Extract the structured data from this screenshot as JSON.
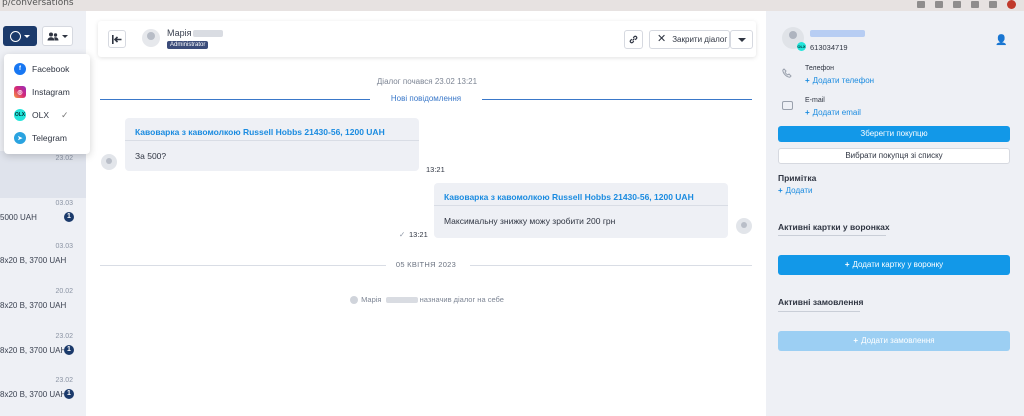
{
  "browser": {
    "url": "p/conversations"
  },
  "left": {
    "items": [
      {
        "date": "23.02",
        "text": "",
        "badge": ""
      },
      {
        "date": "03.03",
        "text": "5000 UAH",
        "badge": "1"
      },
      {
        "date": "03.03",
        "text": "8x20 B, 3700 UAH",
        "badge": ""
      },
      {
        "date": "20.02",
        "text": "8x20 B, 3700 UAH",
        "badge": ""
      },
      {
        "date": "23.02",
        "text": "8x20 B, 3700 UAH",
        "badge": "1"
      },
      {
        "date": "23.02",
        "text": "8x20 B, 3700 UAH",
        "badge": "1"
      }
    ]
  },
  "dropdown": {
    "items": [
      {
        "label": "Facebook",
        "icon": "facebook-icon"
      },
      {
        "label": "Instagram",
        "icon": "instagram-icon"
      },
      {
        "label": "OLX",
        "icon": "olx-icon",
        "checked": true
      },
      {
        "label": "Telegram",
        "icon": "telegram-icon"
      }
    ],
    "olx_abbr": "OLX"
  },
  "header": {
    "agent_name": "Марія",
    "role": "Administrator",
    "close_label": "Закрити діалог"
  },
  "chat": {
    "started": "Діалог почався 23.02 13:21",
    "new_messages": "Нові повідомлення",
    "incoming": {
      "product": "Кавоварка з кавомолкою Russell Hobbs 21430-56, 1200 UAH",
      "text": "За 500?",
      "time": "13:21"
    },
    "outgoing": {
      "product": "Кавоварка з кавомолкою Russell Hobbs 21430-56, 1200 UAH",
      "text": "Максимальну знижку можу зробити 200 грн",
      "time": "13:21",
      "check": "✓"
    },
    "date_divider": "05 КВІТНЯ 2023",
    "assign_name": "Марія",
    "assign_text": "назначив діалог на себе"
  },
  "customer": {
    "phone": "613034719",
    "phone_label": "Телефон",
    "add_phone": "Додати телефон",
    "email_label": "E-mail",
    "add_email": "Додати email",
    "save_purchase": "Зберегти покупцю",
    "choose_purchase": "Вибрати покупця зі списку",
    "note_title": "Примітка",
    "add_note": "Додати",
    "funnels_title": "Активні картки у воронках",
    "add_card": "Додати картку у воронку",
    "orders_title": "Активні замовлення",
    "add_order": "Додати замовлення"
  },
  "colors": {
    "accent": "#1298e8",
    "navy": "#1b3a6b",
    "link": "#1a8be0"
  }
}
